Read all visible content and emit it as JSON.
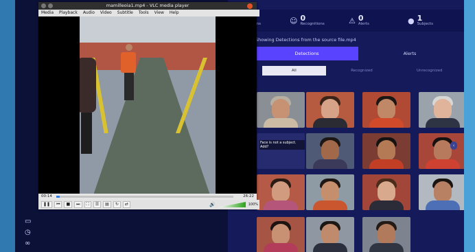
{
  "vlc": {
    "title": "mamilleoia1.mp4 - VLC media player",
    "menu": [
      "Media",
      "Playback",
      "Audio",
      "Video",
      "Subtitle",
      "Tools",
      "View",
      "Help"
    ],
    "time_elapsed": "00:14",
    "time_total": "26:22",
    "seek_progress": 0.01,
    "volume": "100%"
  },
  "dashboard": {
    "stats": [
      {
        "icon": "camera-icon",
        "value": "3",
        "label": "Detections"
      },
      {
        "icon": "face-recognition-icon",
        "value": "0",
        "label": "Recognitions"
      },
      {
        "icon": "alert-icon",
        "value": "0",
        "label": "Alerts"
      },
      {
        "icon": "subjects-icon",
        "value": "1",
        "label": "Subjects"
      }
    ],
    "file_heading": "Showing Detections from the source file.mp4",
    "tabs": [
      "Detections",
      "Alerts"
    ],
    "subtabs": [
      "All",
      "Recognized",
      "Unrecognized"
    ],
    "tile_caption": "Face is not a subject. Add?"
  },
  "colors": {
    "accent": "#5a43ff",
    "panel": "#141a5a",
    "desktop": "#3b8fc6"
  }
}
